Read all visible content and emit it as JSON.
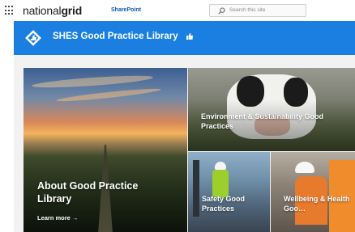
{
  "suite": {
    "brand_light": "national",
    "brand_bold": "grid",
    "app_name": "SharePoint",
    "search_placeholder": "Search this site"
  },
  "site": {
    "title": "SHES Good Practice Library"
  },
  "tiles": {
    "hero": {
      "title": "About Good Practice Library",
      "link": "Learn more →"
    },
    "environment": {
      "title": "Environment & Sustainability Good Practices"
    },
    "safety": {
      "title": "Safety Good Practices"
    },
    "wellbeing": {
      "title": "Wellbeing & Health Goo…"
    }
  },
  "colors": {
    "site_header": "#1a7fe0",
    "brand_app": "#0a57b5"
  },
  "icons": [
    "app-launcher-icon",
    "search-icon",
    "site-logo-icon",
    "thumbs-up-icon",
    "arrow-right-icon"
  ]
}
